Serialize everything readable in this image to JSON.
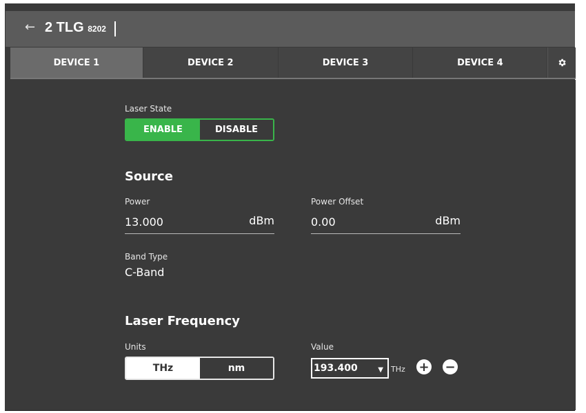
{
  "header": {
    "back_icon": "back-arrow-icon",
    "title": "2 TLG",
    "model": "8202"
  },
  "tabs": [
    {
      "label": "DEVICE 1",
      "active": true
    },
    {
      "label": "DEVICE 2",
      "active": false
    },
    {
      "label": "DEVICE 3",
      "active": false
    },
    {
      "label": "DEVICE 4",
      "active": false
    }
  ],
  "settings_icon": "gear-icon",
  "laser_state": {
    "label": "Laser State",
    "enable_label": "ENABLE",
    "disable_label": "DISABLE",
    "selected": "ENABLE"
  },
  "source": {
    "heading": "Source",
    "power": {
      "label": "Power",
      "value": "13.000",
      "unit": "dBm"
    },
    "power_offset": {
      "label": "Power Offset",
      "value": "0.00",
      "unit": "dBm"
    },
    "band_type": {
      "label": "Band Type",
      "value": "C-Band"
    }
  },
  "laser_frequency": {
    "heading": "Laser Frequency",
    "units_label": "Units",
    "units_options": [
      "THz",
      "nm"
    ],
    "selected_unit": "THz",
    "value_label": "Value",
    "value": "193.400",
    "value_unit": "THz"
  },
  "colors": {
    "accent": "#39b54a",
    "background": "#3a3a3a",
    "header": "#5b5b5b"
  }
}
